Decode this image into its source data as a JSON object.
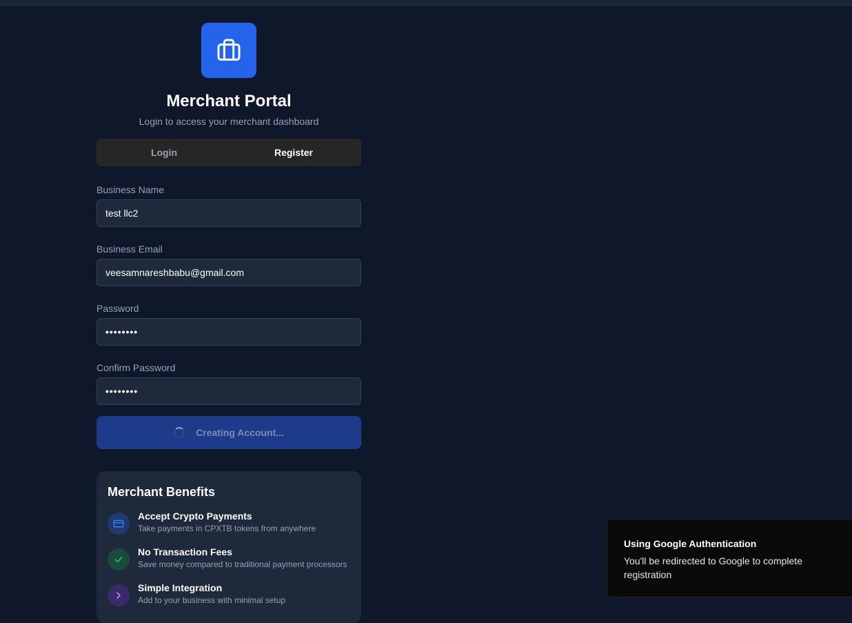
{
  "header": {
    "title": "Merchant Portal",
    "subtitle": "Login to access your merchant dashboard",
    "logo_icon": "briefcase-icon",
    "accent": "#2563eb"
  },
  "tabs": [
    {
      "label": "Login",
      "active": false
    },
    {
      "label": "Register",
      "active": true
    }
  ],
  "form": {
    "business_name": {
      "label": "Business Name",
      "value": "test llc2"
    },
    "business_email": {
      "label": "Business Email",
      "value": "veesamnareshbabu@gmail.com"
    },
    "password": {
      "label": "Password",
      "value": "••••••••"
    },
    "confirm_password": {
      "label": "Confirm Password",
      "value": "••••••••"
    },
    "submit_label": "Creating Account..."
  },
  "benefits": {
    "title": "Merchant Benefits",
    "items": [
      {
        "icon": "credit-card-icon",
        "title": "Accept Crypto Payments",
        "desc": "Take payments in CPXTB tokens from anywhere"
      },
      {
        "icon": "check-icon",
        "title": "No Transaction Fees",
        "desc": "Save money compared to traditional payment processors"
      },
      {
        "icon": "chevron-right-icon",
        "title": "Simple Integration",
        "desc": "Add to your business with minimal setup"
      }
    ]
  },
  "toast": {
    "title": "Using Google Authentication",
    "desc": "You'll be redirected to Google to complete registration"
  }
}
